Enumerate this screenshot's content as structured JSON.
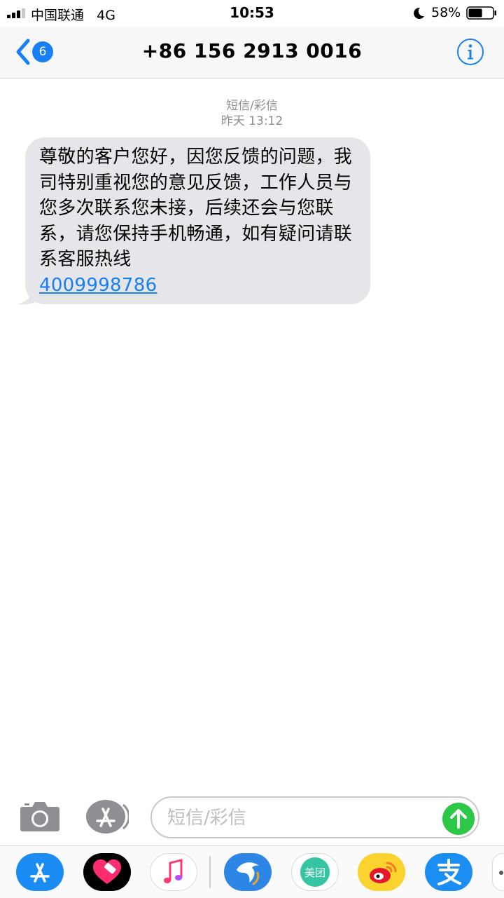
{
  "status_bar": {
    "carrier": "中国联通",
    "network": "4G",
    "time": "10:53",
    "battery_percent": "58%",
    "battery_level": 0.58
  },
  "nav": {
    "back_badge": "6",
    "title": "+86 156 2913 0016",
    "info_icon": "info-icon"
  },
  "conversation": {
    "message_type": "短信/彩信",
    "timestamp": "昨天 13:12",
    "message": {
      "text": "尊敬的客户您好，因您反馈的问题，我司特别重视您的意见反馈，工作人员与您多次联系您未接，后续还会与您联系，请您保持手机畅通，如有疑问请联系客服热线",
      "link": "4009998786"
    }
  },
  "input_bar": {
    "placeholder": "短信/彩信",
    "camera_icon": "camera-icon",
    "appstore_icon": "app-store-icon",
    "send_icon": "send-arrow-icon"
  },
  "app_drawer": {
    "apps": [
      {
        "name": "app-store-icon"
      },
      {
        "name": "heart-app-icon"
      },
      {
        "name": "music-icon"
      },
      {
        "name": "ctrip-icon"
      },
      {
        "name": "meituan-icon",
        "label": "美团"
      },
      {
        "name": "weibo-icon"
      },
      {
        "name": "alipay-icon"
      },
      {
        "name": "more-apps-icon"
      }
    ]
  },
  "colors": {
    "accent_blue": "#1780f6",
    "bubble_gray": "#e5e5ea",
    "send_green": "#2cc948",
    "meta_gray": "#8e8e93"
  }
}
